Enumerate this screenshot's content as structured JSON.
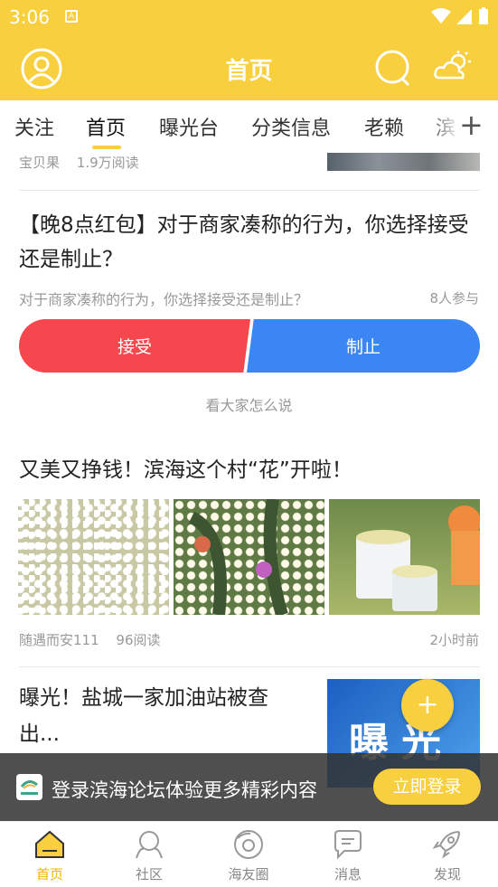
{
  "status_bar": {
    "time": "3:06"
  },
  "app_bar": {
    "title": "首页",
    "avatar_icon": "user-circle-icon",
    "search_icon": "search-icon",
    "weather_icon": "weather-cloud-sun-icon"
  },
  "tabs": [
    "关注",
    "首页",
    "曝光台",
    "分类信息",
    "老赖",
    "滨"
  ],
  "active_tab": "首页",
  "feed": {
    "top_item": {
      "author": "宝贝果",
      "reads": "1.9万阅读"
    },
    "poll": {
      "title": "【晚8点红包】对于商家凑称的行为，你选择接受还是制止？",
      "subtitle": "对于商家凑称的行为，你选择接受还是制止？",
      "participants": "8人参与",
      "option_yes": "接受",
      "option_no": "制止",
      "see_more": "看大家怎么说"
    },
    "article": {
      "title": "又美又挣钱！滨海这个村“花”开啦！",
      "author": "随遇而安111",
      "reads": "96阅读",
      "time": "2小时前"
    },
    "news2": {
      "title": "曝光！盐城一家加油站被查出...",
      "thumb_text": "曝光"
    }
  },
  "fab": {
    "label": "+"
  },
  "login_banner": {
    "message": "登录滨海论坛体验更多精彩内容",
    "button": "立即登录"
  },
  "bottom_nav": [
    {
      "label": "首页",
      "icon": "home-icon",
      "active": true
    },
    {
      "label": "社区",
      "icon": "community-icon",
      "active": false
    },
    {
      "label": "海友圈",
      "icon": "friends-circle-icon",
      "active": false
    },
    {
      "label": "消息",
      "icon": "message-icon",
      "active": false
    },
    {
      "label": "发现",
      "icon": "rocket-icon",
      "active": false
    }
  ],
  "colors": {
    "brand": "#F8CF3E",
    "accept": "#F6474E",
    "reject": "#3B86F2",
    "active_nav": "#F0B400"
  }
}
